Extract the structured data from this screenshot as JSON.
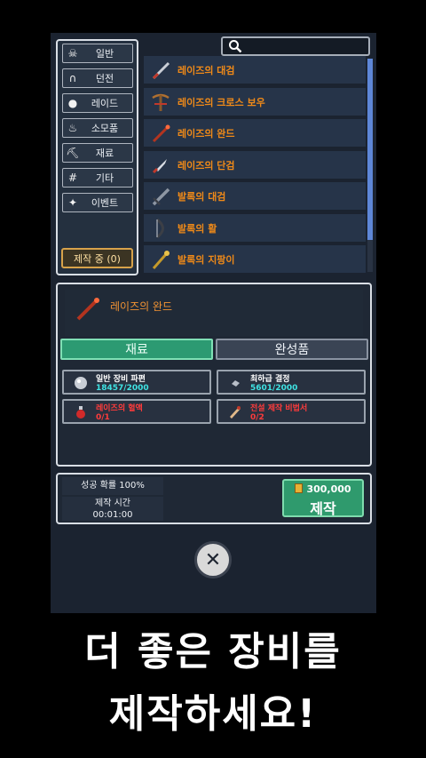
{
  "categories": [
    {
      "label": "일반",
      "icon": "☠"
    },
    {
      "label": "던전",
      "icon": "∩"
    },
    {
      "label": "레이드",
      "icon": "●"
    },
    {
      "label": "소모품",
      "icon": "♨"
    },
    {
      "label": "재료",
      "icon": "⛏"
    },
    {
      "label": "기타",
      "icon": "#"
    },
    {
      "label": "이벤트",
      "icon": "✦"
    }
  ],
  "crafting_status": "제작 중 (0)",
  "search": {
    "icon": "search-icon"
  },
  "items": [
    {
      "name": "레이즈의 대검",
      "color": "#f08a18"
    },
    {
      "name": "레이즈의 크로스 보우",
      "color": "#f08a18"
    },
    {
      "name": "레이즈의 완드",
      "color": "#f08a18"
    },
    {
      "name": "레이즈의 단검",
      "color": "#f08a18"
    },
    {
      "name": "발록의 대검",
      "color": "#f08a18"
    },
    {
      "name": "발록의 활",
      "color": "#f08a18"
    },
    {
      "name": "발록의 지팡이",
      "color": "#f08a18"
    }
  ],
  "detail": {
    "title": "레이즈의 완드",
    "tab_materials": "재료",
    "tab_finished": "완성품",
    "materials": [
      {
        "name": "일반 장비 파편",
        "count": "18457/2000"
      },
      {
        "name": "최하급 결정",
        "count": "5601/2000"
      },
      {
        "name": "레이즈의 혈액",
        "count": "0/1"
      },
      {
        "name": "전설 제작 비법서",
        "count": "0/2"
      }
    ]
  },
  "success_rate": "성공 확률 100%",
  "craft_time_label": "제작 시간",
  "craft_time_value": "00:01:00",
  "cost": "300,000",
  "craft_button": "제작",
  "close_symbol": "✕",
  "caption": {
    "line1": "더 좋은 장비를",
    "line2": "제작하세요!"
  }
}
